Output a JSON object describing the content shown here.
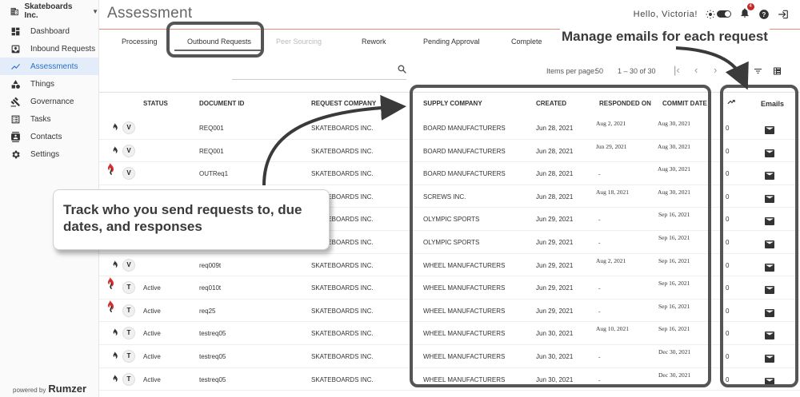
{
  "sidebar": {
    "org_name": "Skateboards Inc.",
    "items": [
      {
        "label": "Dashboard",
        "icon": "dashboard-icon"
      },
      {
        "label": "Inbound Requests",
        "icon": "inbox-icon"
      },
      {
        "label": "Assessments",
        "icon": "trending-icon",
        "active": true
      },
      {
        "label": "Things",
        "icon": "shapes-icon"
      },
      {
        "label": "Governance",
        "icon": "gavel-icon"
      },
      {
        "label": "Tasks",
        "icon": "tasks-icon"
      },
      {
        "label": "Contacts",
        "icon": "contacts-icon"
      },
      {
        "label": "Settings",
        "icon": "gear-icon"
      }
    ],
    "powered_by": "powered by",
    "brand": "Rumzer"
  },
  "header": {
    "title": "Assessment",
    "greeting": "Hello, Victoria!",
    "notification_count": "4"
  },
  "tabs": [
    {
      "label": "Processing"
    },
    {
      "label": "Outbound Requests",
      "active": true
    },
    {
      "label": "Peer Sourcing",
      "disabled": true
    },
    {
      "label": "Rework"
    },
    {
      "label": "Pending Approval"
    },
    {
      "label": "Complete"
    }
  ],
  "toolbar": {
    "items_per_page_label": "Items per page:",
    "items_per_page": "50",
    "range": "1 – 30 of 30"
  },
  "table": {
    "headers": {
      "status": "STATUS",
      "document_id": "DOCUMENT ID",
      "request_company": "REQUEST COMPANY",
      "supply_company": "SUPPLY COMPANY",
      "created": "CREATED",
      "responded_on": "RESPONDED ON",
      "commit_date": "COMMIT DATE",
      "emails": "Emails"
    },
    "rows": [
      {
        "initial": "V",
        "status": "",
        "doc": "REQ001",
        "req": "SKATEBOARDS INC.",
        "sup": "BOARD MANUFACTURERS",
        "created": "Jun 28, 2021",
        "responded": "Aug 2, 2021",
        "commit": "Aug 30, 2021",
        "count": "0",
        "fire": "dark"
      },
      {
        "initial": "V",
        "status": "",
        "doc": "REQ001",
        "req": "SKATEBOARDS INC.",
        "sup": "BOARD MANUFACTURERS",
        "created": "Jun 28, 2021",
        "responded": "Jun 29, 2021",
        "commit": "Aug 30, 2021",
        "count": "0",
        "fire": "dark"
      },
      {
        "initial": "V",
        "status": "",
        "doc": "OUTReq1",
        "req": "SKATEBOARDS INC.",
        "sup": "BOARD MANUFACTURERS",
        "created": "Jun 28, 2021",
        "responded": "-",
        "commit": "Aug 30, 2021",
        "count": "0",
        "fire": "red"
      },
      {
        "initial": "",
        "status": "",
        "doc": "",
        "req": "SKATEBOARDS INC.",
        "sup": "SCREWS INC.",
        "created": "Jun 28, 2021",
        "responded": "Aug 18, 2021",
        "commit": "Aug 30, 2021",
        "count": "0",
        "fire": ""
      },
      {
        "initial": "",
        "status": "",
        "doc": "",
        "req": "SKATEBOARDS INC.",
        "sup": "OLYMPIC SPORTS",
        "created": "Jun 29, 2021",
        "responded": "-",
        "commit": "Sep 16, 2021",
        "count": "0",
        "fire": ""
      },
      {
        "initial": "",
        "status": "",
        "doc": "",
        "req": "SKATEBOARDS INC.",
        "sup": "OLYMPIC SPORTS",
        "created": "Jun 29, 2021",
        "responded": "-",
        "commit": "Sep 16, 2021",
        "count": "0",
        "fire": ""
      },
      {
        "initial": "V",
        "status": "",
        "doc": "req009t",
        "req": "SKATEBOARDS INC.",
        "sup": "WHEEL MANUFACTURERS",
        "created": "Jun 29, 2021",
        "responded": "Aug 2, 2021",
        "commit": "Sep 16, 2021",
        "count": "0",
        "fire": "dark"
      },
      {
        "initial": "T",
        "status": "Active",
        "doc": "req010t",
        "req": "SKATEBOARDS INC.",
        "sup": "WHEEL MANUFACTURERS",
        "created": "Jun 29, 2021",
        "responded": "-",
        "commit": "Sep 16, 2021",
        "count": "0",
        "fire": "red"
      },
      {
        "initial": "T",
        "status": "Active",
        "doc": "req25",
        "req": "SKATEBOARDS INC.",
        "sup": "WHEEL MANUFACTURERS",
        "created": "Jun 29, 2021",
        "responded": "-",
        "commit": "Sep 16, 2021",
        "count": "0",
        "fire": "red"
      },
      {
        "initial": "T",
        "status": "Active",
        "doc": "testreq05",
        "req": "SKATEBOARDS INC.",
        "sup": "WHEEL MANUFACTURERS",
        "created": "Jun 30, 2021",
        "responded": "Aug 10, 2021",
        "commit": "Sep 16, 2021",
        "count": "0",
        "fire": "dark"
      },
      {
        "initial": "T",
        "status": "Active",
        "doc": "testreq05",
        "req": "SKATEBOARDS INC.",
        "sup": "WHEEL MANUFACTURERS",
        "created": "Jun 30, 2021",
        "responded": "-",
        "commit": "Dec 30, 2021",
        "count": "0",
        "fire": "dark"
      },
      {
        "initial": "T",
        "status": "Active",
        "doc": "testreq05",
        "req": "SKATEBOARDS INC.",
        "sup": "WHEEL MANUFACTURERS",
        "created": "Jun 30, 2021",
        "responded": "-",
        "commit": "Dec 30, 2021",
        "count": "0",
        "fire": "dark"
      }
    ]
  },
  "annotations": {
    "top": "Manage emails for each request",
    "box": "Track who you send requests to, due dates, and responses"
  },
  "colors": {
    "accent": "#2c6fc5",
    "active_bg": "#e3edf9",
    "divider": "#e58b7a",
    "fire_red": "#d32f2f",
    "highlight_border": "#555555"
  }
}
